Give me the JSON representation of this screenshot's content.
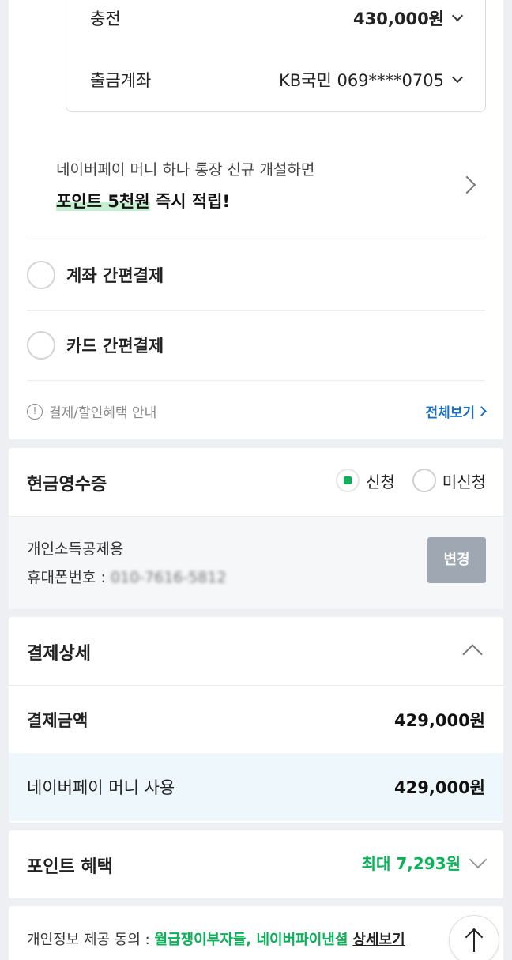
{
  "payment": {
    "charge_label": "충전",
    "charge_value": "430,000원",
    "account_label": "출금계좌",
    "account_value": "KB국민 069****0705"
  },
  "promo": {
    "subtitle": "네이버페이 머니 하나 통장 신규 개설하면",
    "highlight": "포인트 5천원",
    "rest": " 즉시 적립!"
  },
  "methods": [
    {
      "label": "계좌 간편결제"
    },
    {
      "label": "카드 간편결제"
    }
  ],
  "benefit_info": {
    "label": "결제/할인혜택 안내",
    "link": "전체보기"
  },
  "receipt": {
    "title": "현금영수증",
    "option_apply": "신청",
    "option_none": "미신청",
    "type": "개인소득공제용",
    "phone_label": "휴대폰번호 : ",
    "phone_value": "010-7616-5812",
    "change_button": "변경"
  },
  "detail": {
    "title": "결제상세",
    "amount_label": "결제금액",
    "amount_value": "429,000원",
    "money_label": "네이버페이 머니 사용",
    "money_value": "429,000원"
  },
  "points": {
    "title": "포인트 혜택",
    "max_label": "최대 7,293원"
  },
  "consent": {
    "label": "개인정보 제공 동의 : ",
    "parties": "월급쟁이부자들, 네이버파이낸셜",
    "link": "상세보기"
  },
  "colors": {
    "accent_green": "#0ab158",
    "link_blue": "#1a6fc4",
    "button_gray": "#9fa7b2"
  }
}
